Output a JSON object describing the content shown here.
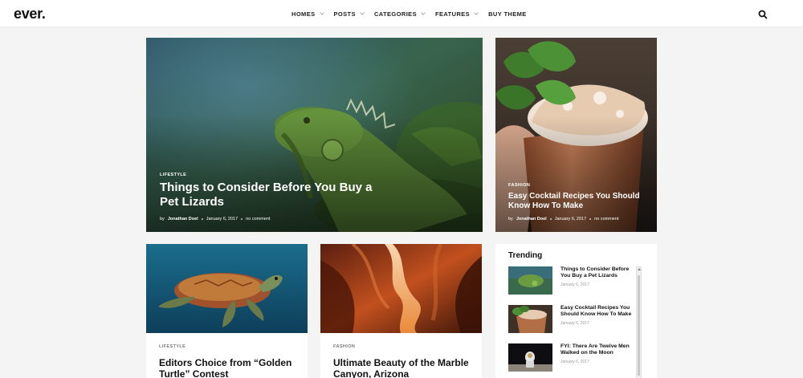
{
  "site": {
    "logo": "ever."
  },
  "nav": {
    "items": [
      {
        "label": "HOMES",
        "has_dropdown": true
      },
      {
        "label": "POSTS",
        "has_dropdown": true
      },
      {
        "label": "CATEGORIES",
        "has_dropdown": true
      },
      {
        "label": "FEATURES",
        "has_dropdown": true
      },
      {
        "label": "BUY THEME",
        "has_dropdown": false
      }
    ],
    "search_icon": "search-icon"
  },
  "hero": {
    "category": "LIFESTYLE",
    "title": "Things to Consider Before You Buy a Pet Lizards",
    "author_prefix": "by",
    "author": "Jonathan Doel",
    "date": "January 6, 2017",
    "comments": "no comment"
  },
  "side_feature": {
    "category": "FASHION",
    "title": "Easy Cocktail Recipes You Should Know How To Make",
    "author_prefix": "by",
    "author": "Jonathan Doel",
    "date": "January 6, 2017",
    "comments": "no comment"
  },
  "posts": [
    {
      "category": "LIFESTYLE",
      "title": "Editors Choice from “Golden Turtle” Contest"
    },
    {
      "category": "FASHION",
      "title": "Ultimate Beauty of the Marble Canyon, Arizona"
    }
  ],
  "trending": {
    "heading": "Trending",
    "items": [
      {
        "title": "Things to Consider Before You Buy a Pet Lizards",
        "date": "January 6, 2017"
      },
      {
        "title": "Easy Cocktail Recipes You Should Know How To Make",
        "date": "January 6, 2017"
      },
      {
        "title": "FYI: There Are Twelve Men Walked on the Moon",
        "date": "January 6, 2017"
      }
    ]
  },
  "colors": {
    "page_bg": "#f4f4f4",
    "text": "#111111",
    "muted": "#999999"
  }
}
